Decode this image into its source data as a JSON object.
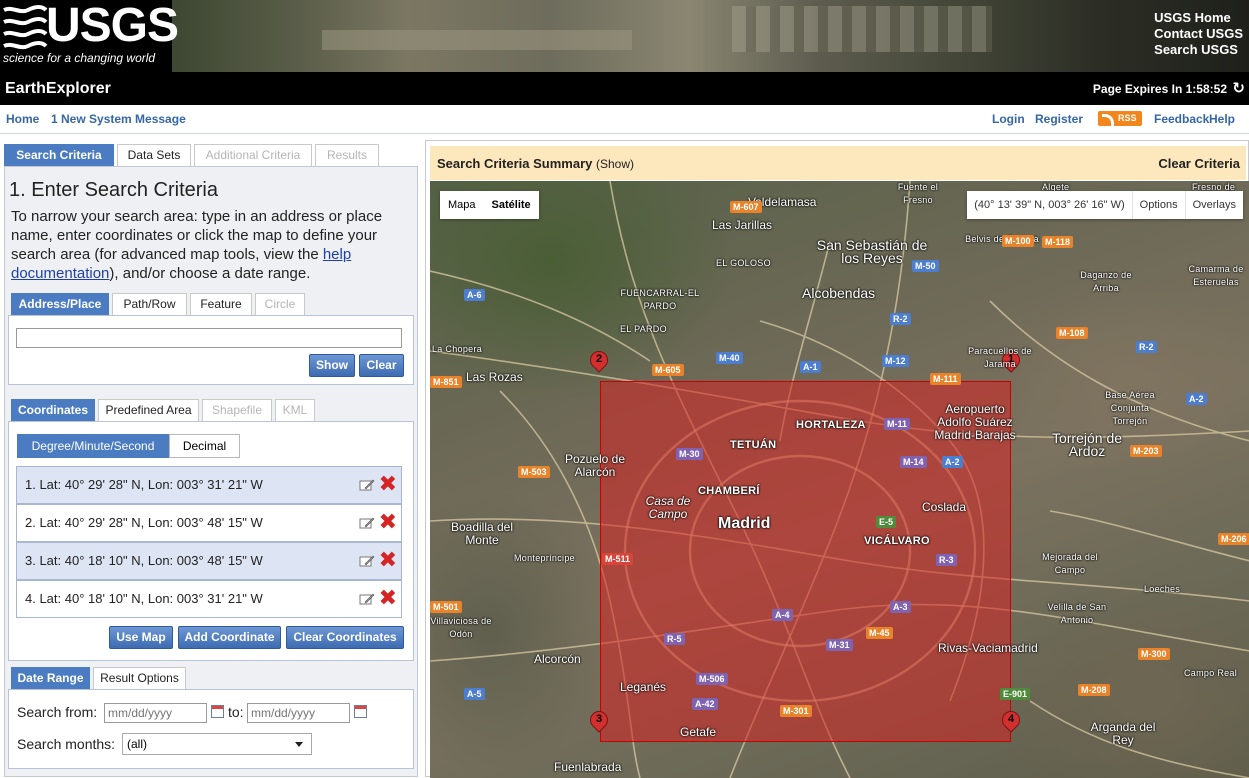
{
  "banner": {
    "logo_text": "USGS",
    "logo_tagline": "science for a changing world",
    "links": [
      "USGS Home",
      "Contact USGS",
      "Search USGS"
    ]
  },
  "titlebar": {
    "title": "EarthExplorer",
    "expires_label": "Page Expires In",
    "expires_value": "1:58:52",
    "refresh_icon": "refresh-icon"
  },
  "nav": {
    "home": "Home",
    "system_message": "1 New System Message",
    "login": "Login",
    "register": "Register",
    "rss": "RSS",
    "feedback": "Feedback",
    "help": "Help"
  },
  "left": {
    "tabs": [
      {
        "label": "Search Criteria",
        "state": "active"
      },
      {
        "label": "Data Sets",
        "state": "normal"
      },
      {
        "label": "Additional Criteria",
        "state": "disabled"
      },
      {
        "label": "Results",
        "state": "disabled"
      }
    ],
    "heading": "1. Enter Search Criteria",
    "intro_before": "To narrow your search area: type in an address or place name, enter coordinates or click the map to define your search area (for advanced map tools, view the ",
    "intro_link": "help documentation",
    "intro_after": "), and/or choose a date range.",
    "location_tabs": [
      {
        "label": "Address/Place",
        "state": "active"
      },
      {
        "label": "Path/Row",
        "state": "normal"
      },
      {
        "label": "Feature",
        "state": "normal"
      },
      {
        "label": "Circle",
        "state": "disabled"
      }
    ],
    "address_value": "",
    "show_button": "Show",
    "clear_button": "Clear",
    "coord_tabs": [
      {
        "label": "Coordinates",
        "state": "active"
      },
      {
        "label": "Predefined Area",
        "state": "normal"
      },
      {
        "label": "Shapefile",
        "state": "disabled"
      },
      {
        "label": "KML",
        "state": "disabled"
      }
    ],
    "format_options": [
      "Degree/Minute/Second",
      "Decimal"
    ],
    "format_selected": "Degree/Minute/Second",
    "coordinates": [
      "1.  Lat: 40° 29' 28\" N, Lon: 003° 31' 21\" W",
      "2.  Lat: 40° 29' 28\" N, Lon: 003° 48' 15\" W",
      "3.  Lat: 40° 18' 10\" N, Lon: 003° 48' 15\" W",
      "4.  Lat: 40° 18' 10\" N, Lon: 003° 31' 21\" W"
    ],
    "use_map_button": "Use Map",
    "add_coordinate_button": "Add Coordinate",
    "clear_coordinates_button": "Clear Coordinates",
    "date_tabs": [
      {
        "label": "Date Range",
        "state": "active"
      },
      {
        "label": "Result Options",
        "state": "normal"
      }
    ],
    "search_from_label": "Search from:",
    "date_placeholder": "mm/dd/yyyy",
    "to_label": "to:",
    "search_months_label": "Search months:",
    "search_months_value": "(all)"
  },
  "summary": {
    "title": "Search Criteria Summary",
    "show_link": "(Show)",
    "clear": "Clear Criteria"
  },
  "map": {
    "type_options": [
      "Mapa",
      "Satélite"
    ],
    "type_selected": "Satélite",
    "cursor_coords": "(40° 13' 39\" N, 003° 26' 16\" W)",
    "options_label": "Options",
    "overlays_label": "Overlays",
    "aoi_color": "#d62323",
    "markers": [
      "1",
      "2",
      "3",
      "4"
    ],
    "places": [
      "Valdelamasa",
      "Las Jarillas",
      "EL GOLOSO",
      "San Sebastián de los Reyes",
      "Alcobendas",
      "FUENCARRAL-EL PARDO",
      "EL PARDO",
      "Las Rozas",
      "La Chopera",
      "Pozuelo de Alarcón",
      "Boadilla del Monte",
      "Montepríncipe",
      "Alcorcón",
      "Fuenlabrada",
      "Leganés",
      "Getafe",
      "Madrid",
      "TETUÁN",
      "HORTALEZA",
      "CHAMBERÍ",
      "Casa de Campo",
      "VICÁLVARO",
      "Coslada",
      "Rivas-Vaciamadrid",
      "Aeropuerto Adolfo Suárez Madrid-Barajas",
      "Torrejón de Ardoz",
      "Paracuellos de Jarama",
      "Belvis de Jarama",
      "Daganzo de Arriba",
      "Camarma de Esteruelas",
      "Base Aérea Conjunta Torrejón",
      "Mejorada del Campo",
      "Velilla de San Antonio",
      "Loeches",
      "Arganda del Rey",
      "Campo Real",
      "Villaviciosa de Odón",
      "Fuente el Fresno",
      "Algete",
      "Fresno de"
    ],
    "roads": [
      "M-607",
      "A-1",
      "M-50",
      "M-40",
      "M-12",
      "M-111",
      "M-100",
      "M-118",
      "M-108",
      "A-6",
      "M-605",
      "M-851",
      "M-503",
      "M-30",
      "M-11",
      "M-14",
      "A-2",
      "R-2",
      "M-203",
      "M-206",
      "E-5",
      "R-3",
      "A-3",
      "M-45",
      "M-31",
      "A-4",
      "A-42",
      "R-5",
      "M-506",
      "M-301",
      "A-5",
      "M-501",
      "M-511",
      "E-901",
      "M-208",
      "M-300",
      "R-2",
      "A-2"
    ]
  }
}
